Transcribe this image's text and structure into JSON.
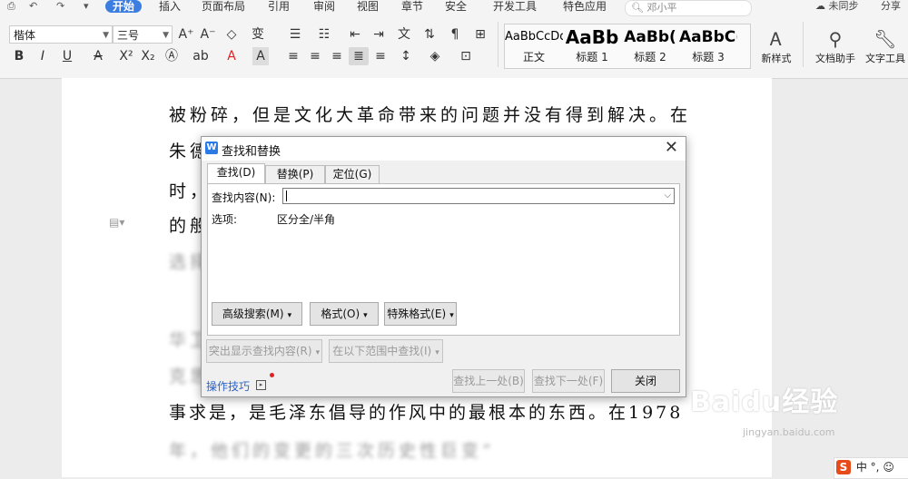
{
  "menubar": {
    "items": [
      "开始",
      "插入",
      "页面布局",
      "引用",
      "审阅",
      "视图",
      "章节",
      "安全",
      "开发工具",
      "特色应用"
    ],
    "active": "开始",
    "search_text": "邓小平",
    "sync_label": "未同步",
    "share_label": "分享"
  },
  "toolbar": {
    "font_name": "楷体",
    "font_size": "三号",
    "styles": [
      {
        "sample": "AaBbCcDd",
        "name": "正文"
      },
      {
        "sample": "AaBb",
        "name": "标题 1"
      },
      {
        "sample": "AaBb(",
        "name": "标题 2"
      },
      {
        "sample": "AaBbC(",
        "name": "标题 3"
      }
    ],
    "new_style_label": "新样式",
    "doc_helper_label": "文档助手",
    "text_tools_label": "文字工具"
  },
  "document": {
    "lines": [
      "被粉碎，但是文化大革命带来的问题并没有得到解决。在",
      "朱德",
      "时，",
      "的般",
      "选择",
      "华卫",
      "克思",
      "事求是，是毛泽东倡导的作风中的最根本的东西。在1978",
      "年，他们的变更的三次历史性巨变”"
    ]
  },
  "dialog": {
    "title": "查找和替换",
    "tabs": [
      "查找(D)",
      "替换(P)",
      "定位(G)"
    ],
    "find_label": "查找内容(N):",
    "find_value": "",
    "options_label": "选项:",
    "options_value": "区分全/半角",
    "advanced_search": "高级搜索(M)",
    "format": "格式(O)",
    "special_format": "特殊格式(E)",
    "highlight_all": "突出显示查找内容(R)",
    "find_in": "在以下范围中查找(I)",
    "tips": "操作技巧",
    "find_prev": "查找上一处(B)",
    "find_next": "查找下一处(F)",
    "close": "关闭"
  },
  "watermark": {
    "brand": "Baidu经验",
    "url": "jingyan.baidu.com"
  },
  "ime": {
    "label": "中"
  },
  "colors": {
    "accent": "#3b7de0",
    "link": "#2c63c6",
    "notify_dot": "#e02020"
  }
}
